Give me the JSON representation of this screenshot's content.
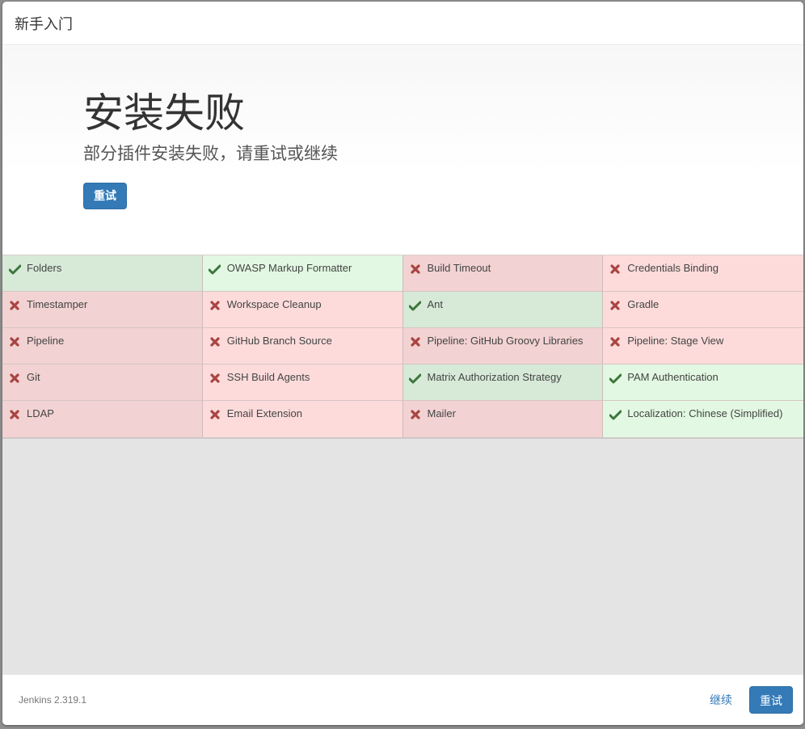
{
  "header": {
    "title": "新手入门"
  },
  "hero": {
    "title": "安装失败",
    "subtitle": "部分插件安装失败，请重试或继续",
    "retry_label": "重试"
  },
  "colors": {
    "primary": "#337ab7",
    "success_icon": "#3c763d",
    "fail_icon": "#a94442",
    "success_dark": "#d6ead7",
    "success_light": "#e2f8e2",
    "fail_dark": "#f2d2d2",
    "fail_light": "#fddbdb"
  },
  "plugins": [
    {
      "name": "Folders",
      "status": "success",
      "icon": "check-icon"
    },
    {
      "name": "OWASP Markup Formatter",
      "status": "success",
      "icon": "check-icon"
    },
    {
      "name": "Build Timeout",
      "status": "failed",
      "icon": "x-icon"
    },
    {
      "name": "Credentials Binding",
      "status": "failed",
      "icon": "x-icon"
    },
    {
      "name": "Timestamper",
      "status": "failed",
      "icon": "x-icon"
    },
    {
      "name": "Workspace Cleanup",
      "status": "failed",
      "icon": "x-icon"
    },
    {
      "name": "Ant",
      "status": "success",
      "icon": "check-icon"
    },
    {
      "name": "Gradle",
      "status": "failed",
      "icon": "x-icon"
    },
    {
      "name": "Pipeline",
      "status": "failed",
      "icon": "x-icon"
    },
    {
      "name": "GitHub Branch Source",
      "status": "failed",
      "icon": "x-icon"
    },
    {
      "name": "Pipeline: GitHub Groovy Libraries",
      "status": "failed",
      "icon": "x-icon"
    },
    {
      "name": "Pipeline: Stage View",
      "status": "failed",
      "icon": "x-icon"
    },
    {
      "name": "Git",
      "status": "failed",
      "icon": "x-icon"
    },
    {
      "name": "SSH Build Agents",
      "status": "failed",
      "icon": "x-icon"
    },
    {
      "name": "Matrix Authorization Strategy",
      "status": "success",
      "icon": "check-icon"
    },
    {
      "name": "PAM Authentication",
      "status": "success",
      "icon": "check-icon"
    },
    {
      "name": "LDAP",
      "status": "failed",
      "icon": "x-icon"
    },
    {
      "name": "Email Extension",
      "status": "failed",
      "icon": "x-icon"
    },
    {
      "name": "Mailer",
      "status": "failed",
      "icon": "x-icon"
    },
    {
      "name": "Localization: Chinese (Simplified)",
      "status": "success",
      "icon": "check-icon"
    }
  ],
  "footer": {
    "version": "Jenkins 2.319.1",
    "continue_label": "继续",
    "retry_label": "重试"
  }
}
